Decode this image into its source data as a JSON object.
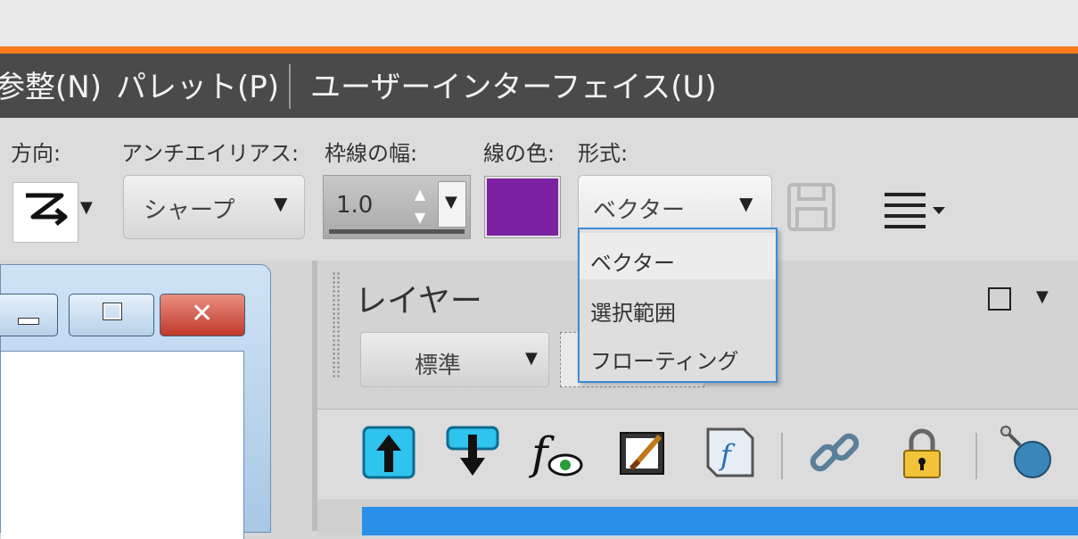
{
  "menubar": {
    "items": [
      {
        "label": "参整(N)"
      },
      {
        "label": "パレット(P)"
      },
      {
        "label": "ユーザーインターフェイス(U)"
      }
    ]
  },
  "toolbar": {
    "direction_label": "方向:",
    "antialias_label": "アンチエイリアス:",
    "antialias_value": "シャープ",
    "border_width_label": "枠線の幅:",
    "border_width_value": "1.0",
    "line_color_label": "線の色:",
    "line_color": "#7c21a2",
    "format_label": "形式:",
    "format_value": "ベクター"
  },
  "format_dropdown": {
    "options": [
      {
        "label": "ベクター",
        "selected": true
      },
      {
        "label": "選択範囲",
        "selected": false
      },
      {
        "label": "フローティング",
        "selected": false
      }
    ]
  },
  "layer_panel": {
    "title": "レイヤー",
    "blend_mode": "標準",
    "icons": [
      "move-up-icon",
      "move-down-icon",
      "effects-visibility-icon",
      "paint-brush-icon",
      "script-icon",
      "link-icon",
      "lock-icon",
      "globe-icon"
    ]
  },
  "colors": {
    "accent": "#ff7a1a",
    "menubar": "#4a4a4a",
    "dropdown_border": "#3c8cd8",
    "layer_selected": "#2a8fe8"
  }
}
